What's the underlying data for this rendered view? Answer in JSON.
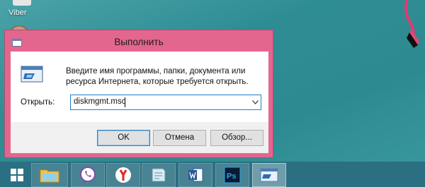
{
  "desktop": {
    "icons": [
      {
        "label": "Viber"
      }
    ]
  },
  "dialog": {
    "title": "Выполнить",
    "description": "Введите имя программы, папки, документа или ресурса Интернета, которые требуется открыть.",
    "open_label": "Открыть:",
    "open_value": "diskmgmt.msc",
    "buttons": {
      "ok": "OK",
      "cancel": "Отмена",
      "browse": "Обзор..."
    }
  },
  "taskbar": {
    "items": [
      "start",
      "file-explorer",
      "viber",
      "yandex-browser",
      "notepad",
      "word",
      "photoshop",
      "run"
    ]
  },
  "colors": {
    "dialog_frame": "#e3668e",
    "taskbar": "#2b6f82",
    "desktop": "#2e8d93"
  }
}
